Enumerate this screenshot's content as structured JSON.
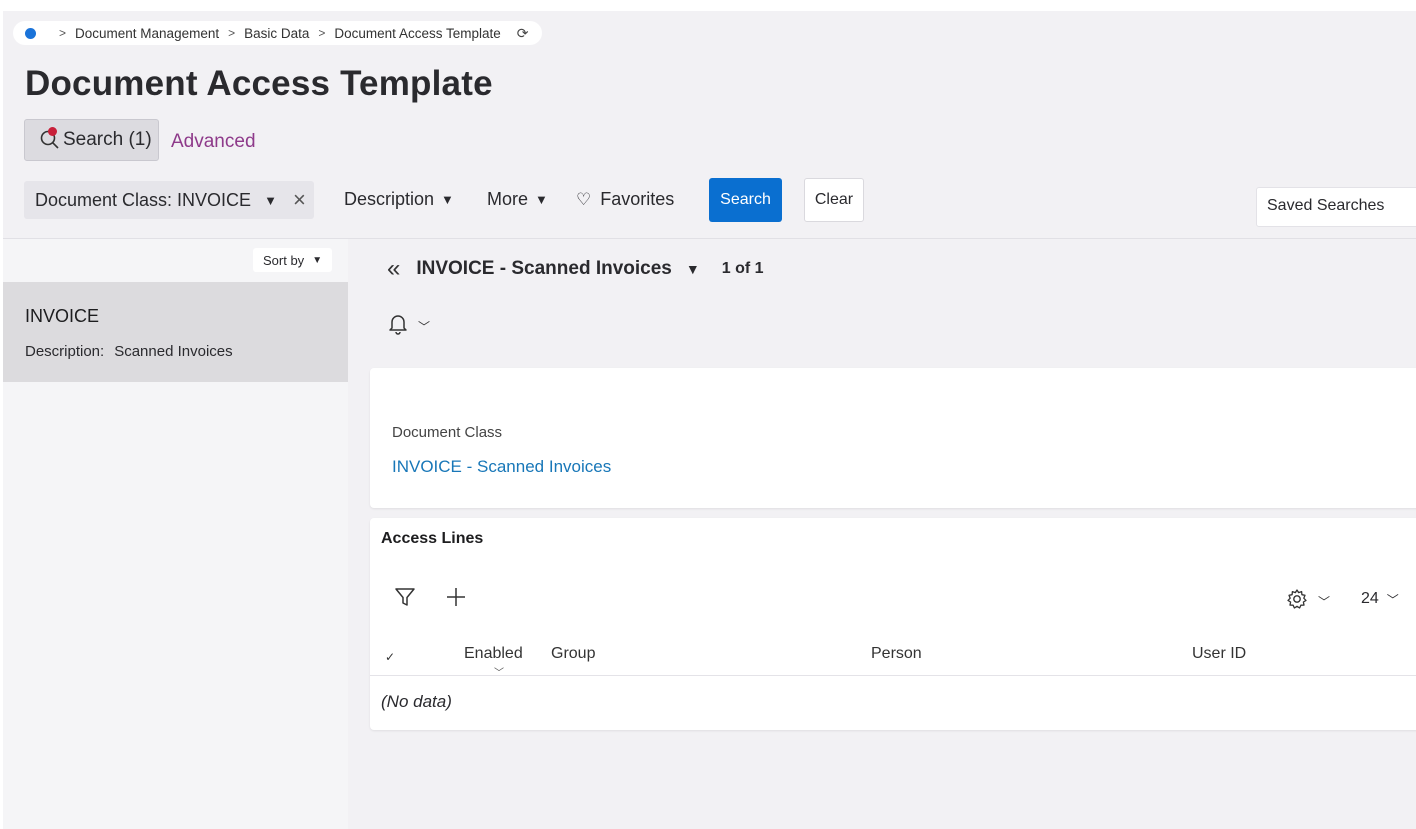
{
  "breadcrumb": {
    "items": [
      "Document Management",
      "Basic Data",
      "Document Access Template"
    ],
    "separator": ">",
    "refresh_icon": "refresh-icon"
  },
  "page_title": "Document Access Template",
  "search_tab": {
    "label": "Search (1)",
    "icon": "search-icon"
  },
  "advanced_label": "Advanced",
  "filters": {
    "chip_label": "Document Class: INVOICE",
    "description_label": "Description",
    "more_label": "More",
    "favorites_label": "Favorites",
    "search_button": "Search",
    "clear_button": "Clear",
    "saved_searches": "Saved Searches"
  },
  "list": {
    "sort_label": "Sort by",
    "items": [
      {
        "name": "INVOICE",
        "desc_key": "Description:",
        "desc_value": "Scanned Invoices"
      }
    ]
  },
  "record": {
    "title": "INVOICE - Scanned Invoices",
    "count": "1 of 1"
  },
  "detail": {
    "field_label": "Document Class",
    "field_value": "INVOICE - Scanned Invoices"
  },
  "access_lines": {
    "title": "Access Lines",
    "page_size": "24",
    "columns": [
      "Enabled",
      "Group",
      "Person",
      "User ID"
    ],
    "empty_text": "(No data)"
  },
  "colors": {
    "primary": "#0a6fd0",
    "link": "#1877b8",
    "advanced": "#8e3a8a",
    "badge": "#c8203a"
  }
}
